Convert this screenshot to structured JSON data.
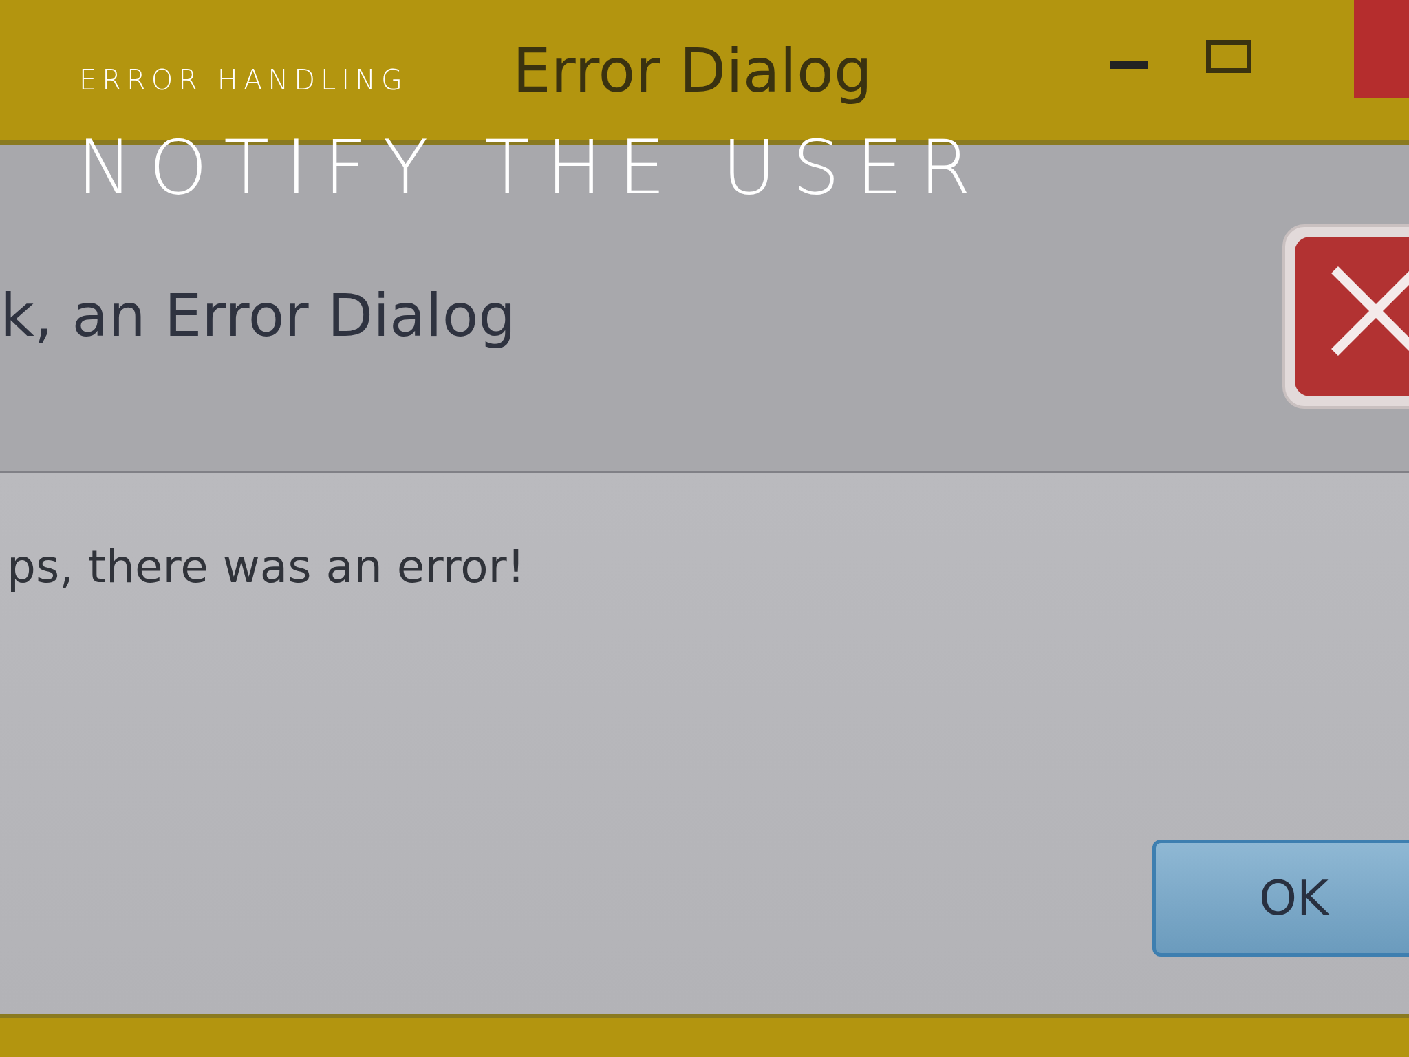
{
  "slide": {
    "kicker": "ERROR HANDLING",
    "title": "NOTIFY THE USER"
  },
  "dialog": {
    "title": "Error Dialog",
    "heading": "k, an Error Dialog",
    "message": "ps, there was an error!",
    "buttons": [
      "OK"
    ]
  }
}
